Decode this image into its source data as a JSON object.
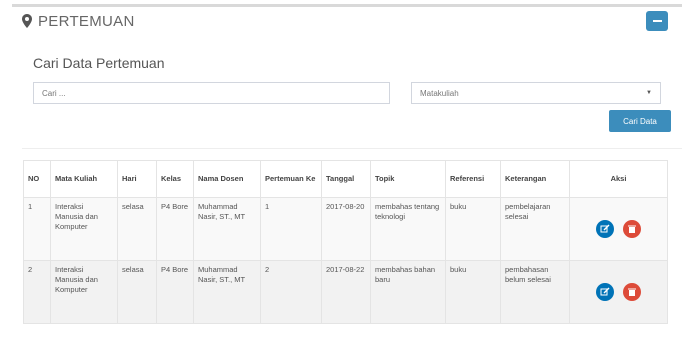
{
  "header": {
    "title": "PERTEMUAN"
  },
  "search": {
    "title": "Cari Data Pertemuan",
    "placeholder": "Cari ...",
    "select_value": "Matakuliah",
    "button_label": "Cari Data"
  },
  "table": {
    "headers": [
      "NO",
      "Mata Kuliah",
      "Hari",
      "Kelas",
      "Nama Dosen",
      "Pertemuan Ke",
      "Tanggal",
      "Topik",
      "Referensi",
      "Keterangan",
      "Aksi"
    ],
    "rows": [
      {
        "no": "1",
        "mata_kuliah": "Interaksi Manusia dan Komputer",
        "hari": "selasa",
        "kelas": "P4 Bore",
        "dosen": "Muhammad Nasir, ST., MT",
        "pertemuan": "1",
        "tanggal": "2017-08-20",
        "topik": "membahas tentang teknologi",
        "referensi": "buku",
        "keterangan": "pembelajaran selesai"
      },
      {
        "no": "2",
        "mata_kuliah": "Interaksi Manusia dan Komputer",
        "hari": "selasa",
        "kelas": "P4 Bore",
        "dosen": "Muhammad Nasir, ST., MT",
        "pertemuan": "2",
        "tanggal": "2017-08-22",
        "topik": "membahas bahan baru",
        "referensi": "buku",
        "keterangan": "pembahasan belum selesai"
      }
    ]
  },
  "colors": {
    "primary": "#3c8dbc",
    "edit": "#0073b7",
    "delete": "#dd4b39"
  }
}
